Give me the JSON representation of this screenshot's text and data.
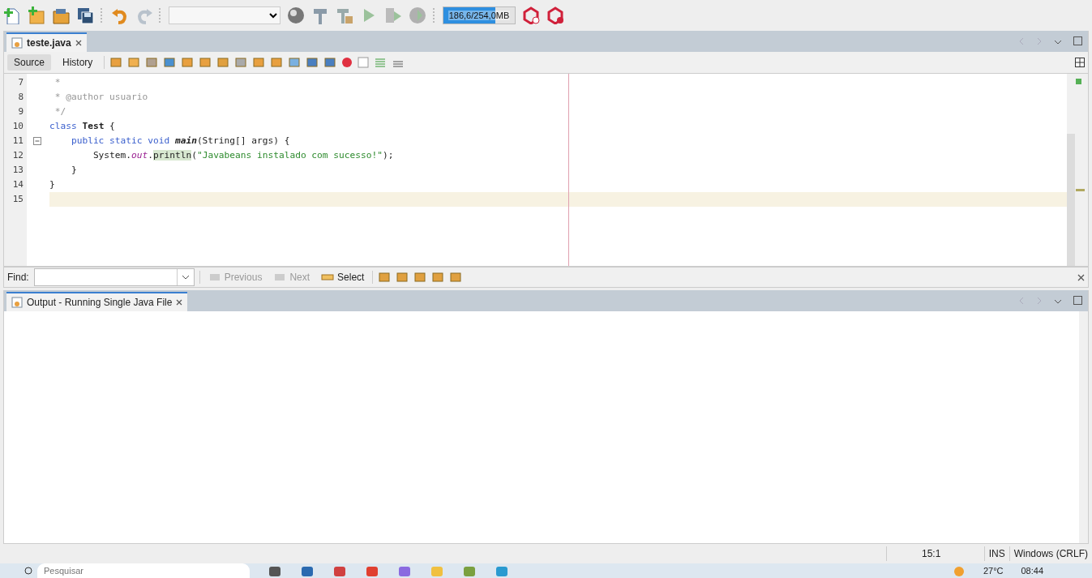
{
  "toolbar": {
    "memory": {
      "reading": "186,6/254,0MB",
      "level": 0.73
    }
  },
  "editor": {
    "tabs": [
      {
        "label": "teste.java",
        "selected": true
      }
    ],
    "view_tabs": [
      {
        "label": "Source",
        "selected": true
      },
      {
        "label": "History",
        "selected": false
      }
    ],
    "lines": [
      {
        "number": "7",
        "current": false,
        "collapsible": false,
        "tokens": [
          {
            "kind": "comment",
            "text": " *"
          }
        ]
      },
      {
        "number": "8",
        "current": false,
        "collapsible": false,
        "tokens": [
          {
            "kind": "comment",
            "text": " * @author usuario"
          }
        ]
      },
      {
        "number": "9",
        "current": false,
        "collapsible": false,
        "tokens": [
          {
            "kind": "comment",
            "text": " */"
          }
        ]
      },
      {
        "number": "10",
        "current": false,
        "collapsible": false,
        "tokens": [
          {
            "kind": "keyword",
            "text": "class "
          },
          {
            "kind": "bold",
            "text": "Test"
          },
          {
            "kind": "plain",
            "text": " {"
          }
        ]
      },
      {
        "number": "11",
        "current": false,
        "collapsible": true,
        "tokens": [
          {
            "kind": "keyword",
            "text": "    public static void "
          },
          {
            "kind": "method",
            "text": "main"
          },
          {
            "kind": "plain",
            "text": "(String[] args) {"
          }
        ]
      },
      {
        "number": "12",
        "current": false,
        "collapsible": false,
        "tokens": [
          {
            "kind": "plain",
            "text": "        System."
          },
          {
            "kind": "field",
            "text": "out"
          },
          {
            "kind": "plain",
            "text": "."
          },
          {
            "kind": "mark",
            "text": "println"
          },
          {
            "kind": "plain",
            "text": "("
          },
          {
            "kind": "string",
            "text": "\"Javabeans instalado com sucesso!\""
          },
          {
            "kind": "plain",
            "text": ");"
          }
        ]
      },
      {
        "number": "13",
        "current": false,
        "collapsible": false,
        "tokens": [
          {
            "kind": "plain",
            "text": "    }"
          }
        ]
      },
      {
        "number": "14",
        "current": false,
        "collapsible": false,
        "tokens": [
          {
            "kind": "plain",
            "text": "}"
          }
        ]
      },
      {
        "number": "15",
        "current": true,
        "collapsible": false
      }
    ]
  },
  "find_bar": {
    "label": "Find:",
    "buttons": [
      {
        "label": "Previous",
        "disabled": true
      },
      {
        "label": "Next",
        "disabled": true
      },
      {
        "label": "Select",
        "disabled": false
      }
    ]
  },
  "output": {
    "tabs": [
      {
        "label": "Output - Running Single Java File",
        "selected": true
      }
    ]
  },
  "status_bar": {
    "position": "15:1",
    "mode": "INS",
    "line_endings": "Windows (CRLF)"
  },
  "taskbar": {
    "search": {
      "placeholder": "Pesquisar"
    },
    "weather": "27°C",
    "clock": "08:44"
  }
}
